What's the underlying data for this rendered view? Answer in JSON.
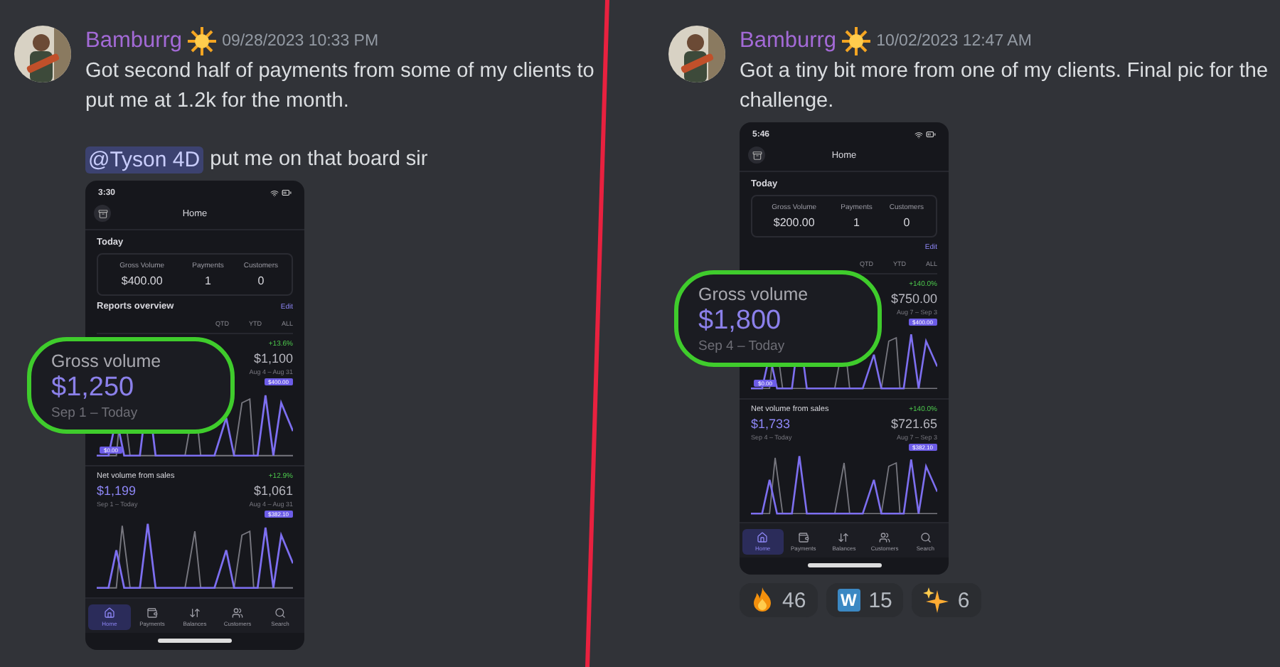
{
  "posts": [
    {
      "author": "Bamburrg",
      "timestamp": "09/28/2023 10:33 PM",
      "paragraphs": [
        "Got second half of payments from some of my clients to put me at 1.2k for the month."
      ],
      "mention": "@Tyson 4D",
      "mention_text": "put me on that board sir",
      "phone": {
        "time": "3:30",
        "title": "Home",
        "today": "Today",
        "stats": [
          {
            "label": "Gross Volume",
            "value": "$400.00"
          },
          {
            "label": "Payments",
            "value": "1"
          },
          {
            "label": "Customers",
            "value": "0"
          }
        ],
        "reports": "Reports overview",
        "edit": "Edit",
        "ranges": [
          "QTD",
          "YTD",
          "ALL"
        ],
        "cards": [
          {
            "change": "+13.6%",
            "compare": "$1,100",
            "compare_range": "Aug 4 – Aug 31",
            "chips": [
              "$400.00",
              "$0.00"
            ]
          },
          {
            "title": "Net volume from sales",
            "value": "$1,199",
            "range": "Sep 1 – Today",
            "change": "+12.9%",
            "compare": "$1,061",
            "compare_range": "Aug 4 – Aug 31",
            "chips": [
              "$382.10"
            ]
          }
        ],
        "nav": [
          {
            "label": "Home",
            "selected": true
          },
          {
            "label": "Payments",
            "selected": false
          },
          {
            "label": "Balances",
            "selected": false
          },
          {
            "label": "Customers",
            "selected": false
          },
          {
            "label": "Search",
            "selected": false
          }
        ]
      },
      "callout": {
        "title": "Gross volume",
        "value": "$1,250",
        "range": "Sep 1 – Today"
      }
    },
    {
      "author": "Bamburrg",
      "timestamp": "10/02/2023 12:47 AM",
      "paragraphs": [
        "Got a tiny bit more from one of my clients. Final pic for the challenge."
      ],
      "phone": {
        "time": "5:46",
        "title": "Home",
        "today": "Today",
        "stats": [
          {
            "label": "Gross Volume",
            "value": "$200.00"
          },
          {
            "label": "Payments",
            "value": "1"
          },
          {
            "label": "Customers",
            "value": "0"
          }
        ],
        "edit": "Edit",
        "ranges": [
          "QTD",
          "YTD",
          "ALL"
        ],
        "cards": [
          {
            "change": "+140.0%",
            "compare": "$750.00",
            "compare_range": "Aug 7 – Sep 3",
            "chips": [
              "$400.00",
              "$0.00"
            ]
          },
          {
            "title": "Net volume from sales",
            "value": "$1,733",
            "range": "Sep 4 – Today",
            "change": "+140.0%",
            "compare": "$721.65",
            "compare_range": "Aug 7 – Sep 3",
            "chips": [
              "$382.10"
            ]
          }
        ],
        "nav": [
          {
            "label": "Home",
            "selected": true
          },
          {
            "label": "Payments",
            "selected": false
          },
          {
            "label": "Balances",
            "selected": false
          },
          {
            "label": "Customers",
            "selected": false
          },
          {
            "label": "Search",
            "selected": false
          }
        ]
      },
      "callout": {
        "title": "Gross volume",
        "value": "$1,800",
        "range": "Sep 4 – Today"
      },
      "reactions": [
        {
          "kind": "fire",
          "count": "46"
        },
        {
          "kind": "letter",
          "letter": "W",
          "count": "15"
        },
        {
          "kind": "sparkles",
          "count": "6"
        }
      ]
    }
  ]
}
